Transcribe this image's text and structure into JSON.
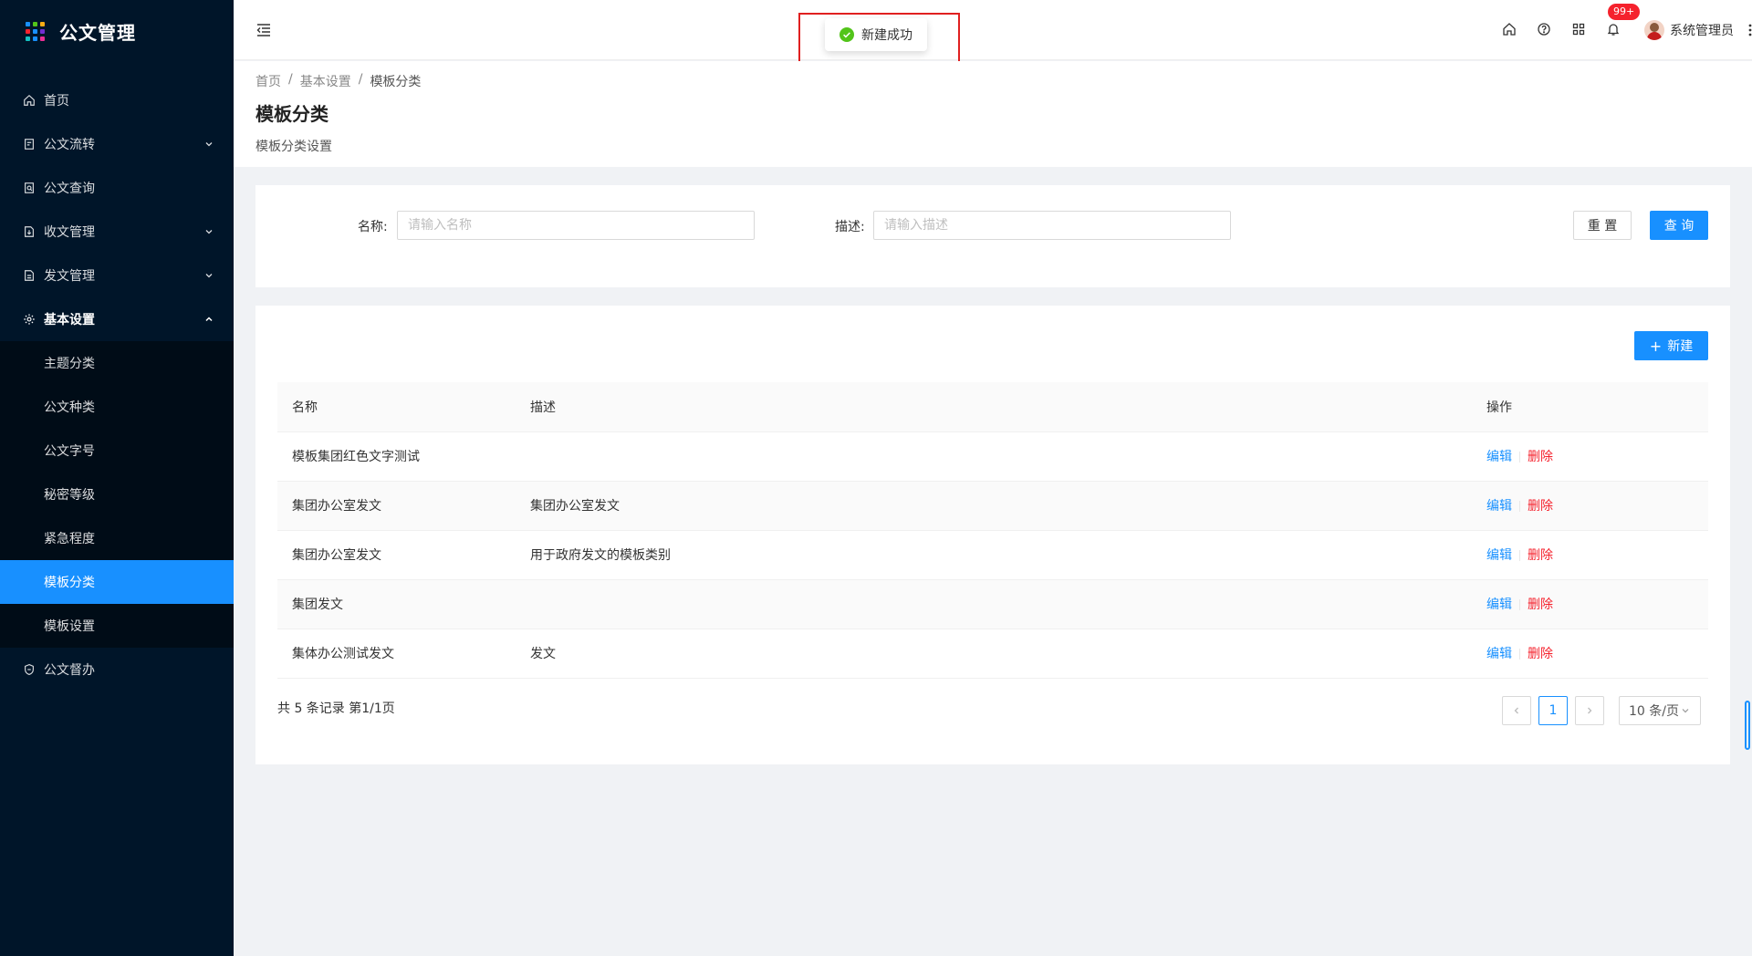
{
  "app": {
    "title": "公文管理",
    "logo_colors": [
      "#1890ff",
      "#52c41a",
      "#faad14",
      "#f5222d",
      "#1890ff",
      "#722ed1",
      "#13c2c2",
      "#1890ff",
      "#eb2f96"
    ]
  },
  "sidebar": {
    "items": [
      {
        "label": "首页",
        "icon": "home-icon"
      },
      {
        "label": "公文流转",
        "icon": "document-flow-icon",
        "has_children": true
      },
      {
        "label": "公文查询",
        "icon": "document-search-icon"
      },
      {
        "label": "收文管理",
        "icon": "inbox-document-icon",
        "has_children": true
      },
      {
        "label": "发文管理",
        "icon": "outbox-document-icon",
        "has_children": true
      },
      {
        "label": "基本设置",
        "icon": "settings-icon",
        "expanded": true
      }
    ],
    "sub_items": [
      {
        "label": "主题分类"
      },
      {
        "label": "公文种类"
      },
      {
        "label": "公文字号"
      },
      {
        "label": "秘密等级"
      },
      {
        "label": "紧急程度"
      },
      {
        "label": "模板分类",
        "active": true
      },
      {
        "label": "模板设置"
      }
    ],
    "last_item": {
      "label": "公文督办",
      "icon": "supervise-icon"
    }
  },
  "header": {
    "notification_badge": "99+",
    "user_name": "系统管理员"
  },
  "toast": {
    "message": "新建成功",
    "status": "success"
  },
  "page": {
    "breadcrumb": [
      "首页",
      "基本设置",
      "模板分类"
    ],
    "title": "模板分类",
    "subtitle": "模板分类设置"
  },
  "search": {
    "name_label": "名称:",
    "name_placeholder": "请输入名称",
    "desc_label": "描述:",
    "desc_placeholder": "请输入描述",
    "reset_label": "重 置",
    "query_label": "查 询"
  },
  "table": {
    "new_label": "新建",
    "columns": [
      "名称",
      "描述",
      "操作"
    ],
    "rows": [
      {
        "name": "模板集团红色文字测试",
        "desc": ""
      },
      {
        "name": "集团办公室发文",
        "desc": "集团办公室发文"
      },
      {
        "name": "集团办公室发文",
        "desc": "用于政府发文的模板类别"
      },
      {
        "name": "集团发文",
        "desc": ""
      },
      {
        "name": "集体办公测试发文",
        "desc": "发文"
      }
    ],
    "edit_label": "编辑",
    "delete_label": "删除"
  },
  "pagination": {
    "total_text": "共 5 条记录 第1/1页",
    "current_page": "1",
    "page_size": "10 条/页"
  }
}
